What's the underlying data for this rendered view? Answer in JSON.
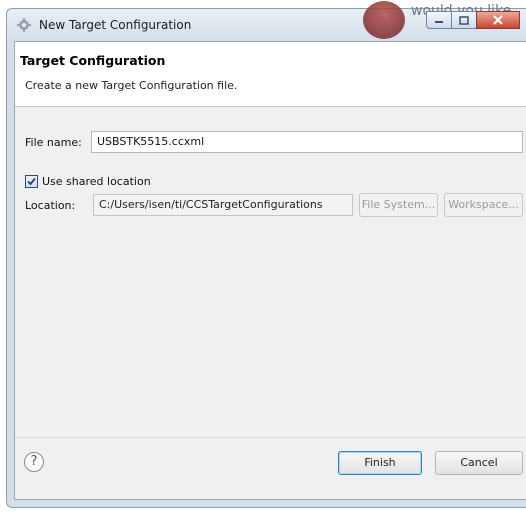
{
  "window": {
    "title": "New Target Configuration",
    "background_hint": "would you like"
  },
  "header": {
    "title": "Target Configuration",
    "description": "Create a new Target Configuration file."
  },
  "form": {
    "file_name_label": "File name:",
    "file_name_value": "USBSTK5515.ccxml",
    "use_shared_label": "Use shared location",
    "use_shared_checked": true,
    "location_label": "Location:",
    "location_value": "C:/Users/isen/ti/CCSTargetConfigurations",
    "file_system_button": "File System...",
    "workspace_button": "Workspace..."
  },
  "footer": {
    "help_glyph": "?",
    "finish_button": "Finish",
    "cancel_button": "Cancel"
  },
  "colors": {
    "accent": "#3c7fb1",
    "close_button": "#c84731",
    "dialog_bg": "#f0f0f0"
  }
}
